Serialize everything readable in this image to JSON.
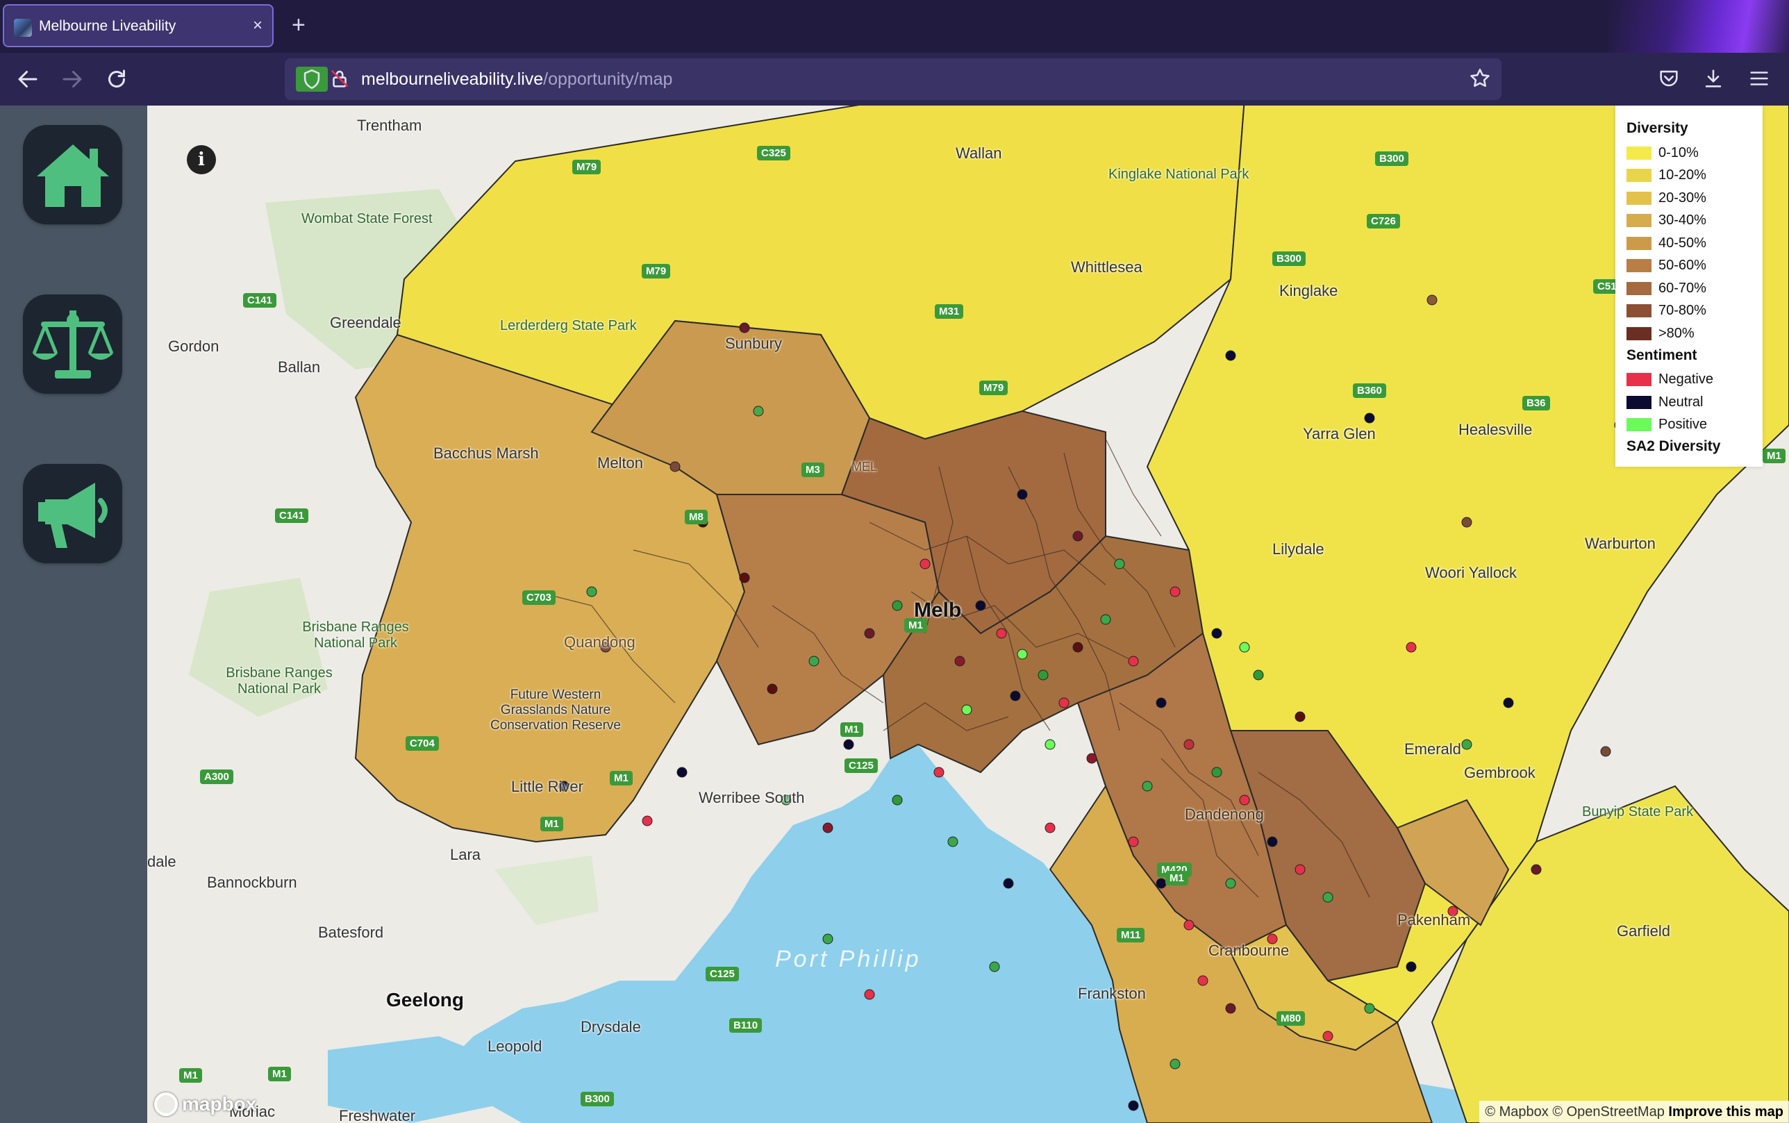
{
  "browser": {
    "tab_title": "Melbourne Liveability",
    "tab_close": "×",
    "new_tab": "+",
    "url_host": "melbourneliveability.live",
    "url_path": "/opportunity/map"
  },
  "sidebar": {
    "items": [
      {
        "name": "home",
        "icon": "home-icon"
      },
      {
        "name": "compare",
        "icon": "scales-icon"
      },
      {
        "name": "opportunity",
        "icon": "megaphone-icon"
      }
    ]
  },
  "map": {
    "info_button": "i",
    "legend": {
      "diversity_title": "Diversity",
      "diversity": [
        {
          "label": "0-10%",
          "color": "#f4ea4a"
        },
        {
          "label": "10-20%",
          "color": "#e9d54a"
        },
        {
          "label": "20-30%",
          "color": "#e3c24c"
        },
        {
          "label": "30-40%",
          "color": "#d6ac4c"
        },
        {
          "label": "40-50%",
          "color": "#cc9b4a"
        },
        {
          "label": "50-60%",
          "color": "#b97e45"
        },
        {
          "label": "60-70%",
          "color": "#a56a3f"
        },
        {
          "label": "70-80%",
          "color": "#8d4f34"
        },
        {
          "label": ">80%",
          "color": "#6b2e22"
        }
      ],
      "sentiment_title": "Sentiment",
      "sentiment": [
        {
          "label": "Negative",
          "color": "#e8304a"
        },
        {
          "label": "Neutral",
          "color": "#0b0a30"
        },
        {
          "label": "Positive",
          "color": "#6bfa5a"
        }
      ],
      "sa2_title": "SA2 Diversity"
    },
    "place_labels": {
      "trentham": "Trentham",
      "wombat": "Wombat State Forest",
      "greendale": "Greendale",
      "gordon": "Gordon",
      "ballan": "Ballan",
      "bacchus": "Bacchus Marsh",
      "melton": "Melton",
      "brisbane1": "Brisbane Ranges National Park",
      "brisbane2": "Brisbane Ranges National Park",
      "quandong": "Quandong",
      "grasslands": "Future Western Grasslands Nature Conservation Reserve",
      "little_river": "Little River",
      "werribee": "Werribee South",
      "lara": "Lara",
      "dale": "dale",
      "bannockburn": "Bannockburn",
      "batesford": "Batesford",
      "geelong": "Geelong",
      "leopold": "Leopold",
      "drysdale": "Drysdale",
      "moriac": "Moriac",
      "freshwater": "Freshwater",
      "port_phillip": "Port Phillip",
      "frankston": "Frankston",
      "cranbourne": "Cranbourne",
      "dandenong": "Dandenong",
      "pakenham": "Pakenham",
      "garfield": "Garfield",
      "gembrook": "Gembrook",
      "emerald": "Emerald",
      "wallan": "Wallan",
      "whittlesea": "Whittlesea",
      "kinglake": "Kinglake National Park",
      "kinglake_town": "Kinglake",
      "sunbury": "Sunbury",
      "lerderderg": "Lerderderg State Park",
      "yarra_glen": "Yarra Glen",
      "healesville": "Healesville",
      "lilydale": "Lilydale",
      "warburton": "Warburton",
      "woori": "Woori Yallock",
      "bunyip": "Bunyip State Park",
      "mel": "MEL",
      "melb": "Melb"
    },
    "roads": [
      "M79",
      "C325",
      "M79",
      "C141",
      "C141",
      "M8",
      "C703",
      "C704",
      "A300",
      "M1",
      "M1",
      "M1",
      "M1",
      "M1",
      "C125",
      "C125",
      "B110",
      "B300",
      "B300",
      "C726",
      "B300",
      "B360",
      "B36",
      "C51",
      "M1",
      "M420",
      "M80",
      "M31",
      "M79",
      "M3",
      "M1",
      "M11",
      "M1"
    ],
    "attribution": "© Mapbox © OpenStreetMap",
    "improve": "Improve this map",
    "mapbox": "mapbox"
  }
}
